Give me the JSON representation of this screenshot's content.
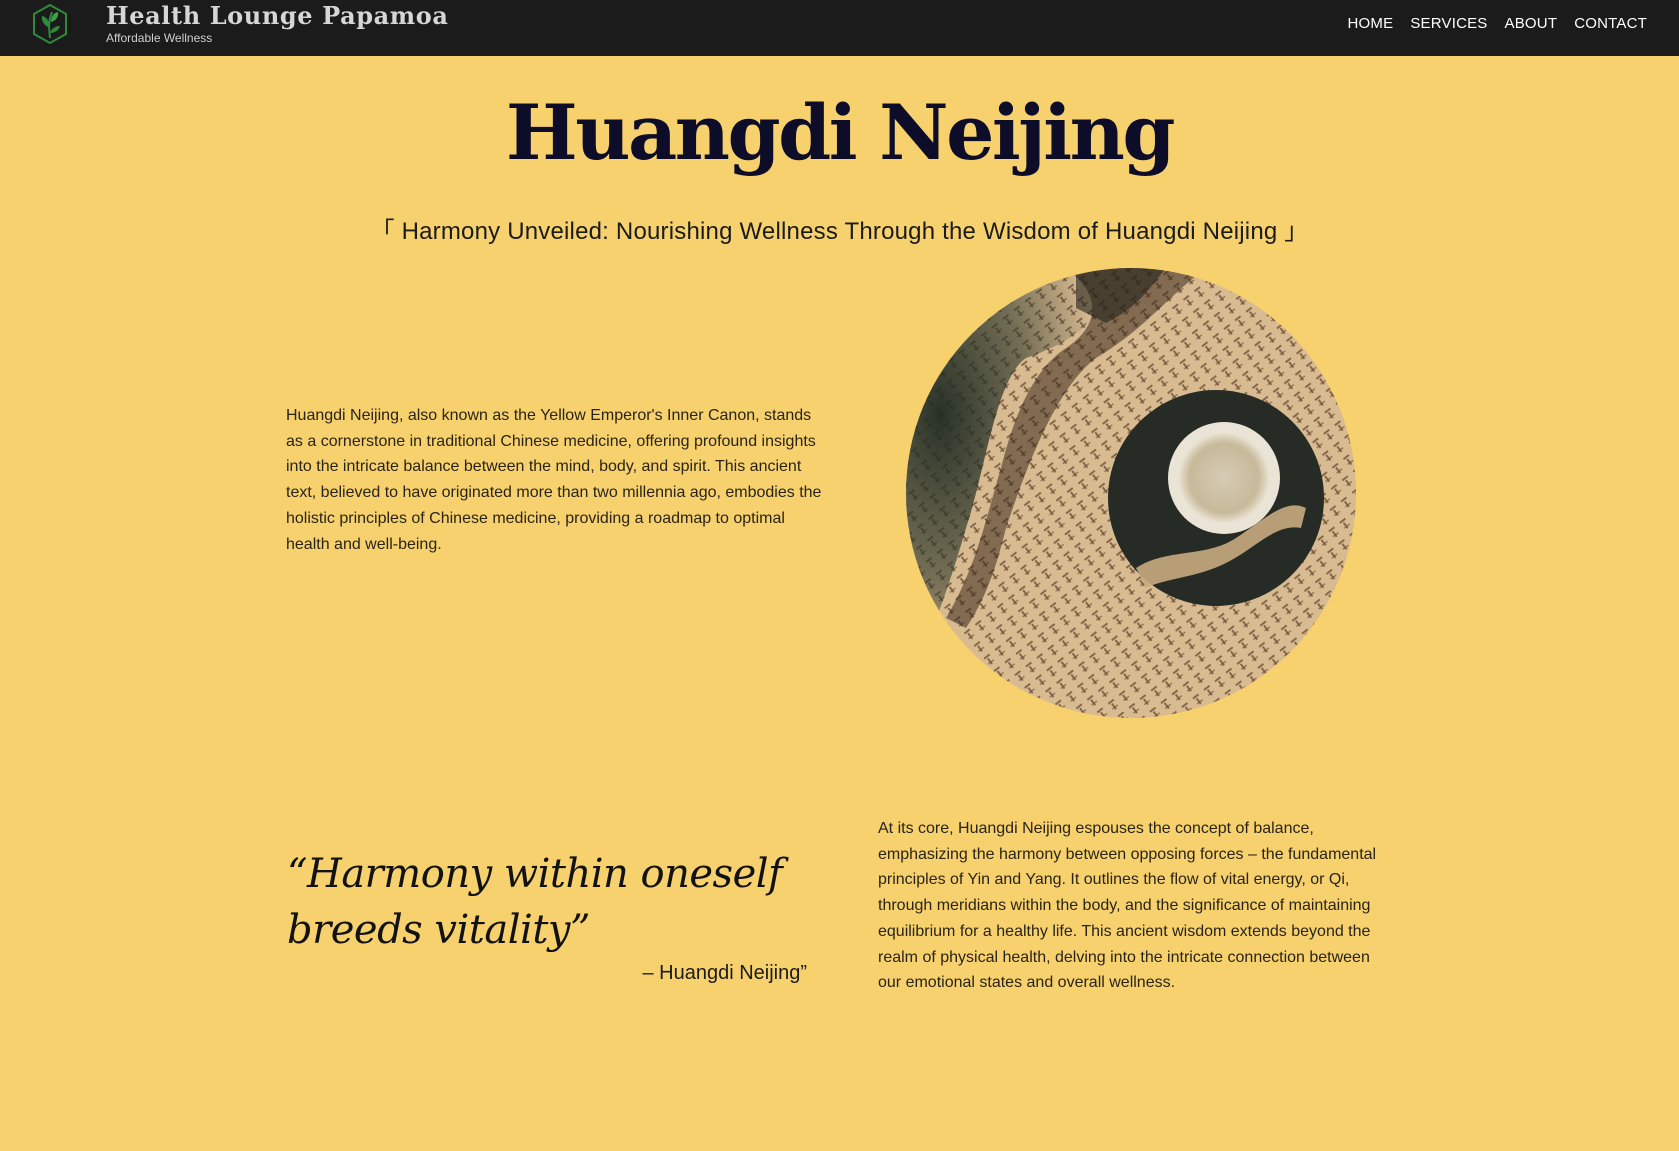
{
  "header": {
    "brand": "Health Lounge Papamoa",
    "tagline": "Affordable Wellness",
    "nav": [
      "HOME",
      "SERVICES",
      "ABOUT",
      "CONTACT"
    ]
  },
  "main": {
    "title": "Huangdi Neijing",
    "subtitle": "「 Harmony Unveiled: Nourishing Wellness Through the Wisdom of Huangdi Neijing 」",
    "intro": "Huangdi Neijing, also known as the Yellow Emperor's Inner Canon, stands as a cornerstone in traditional Chinese medicine, offering profound insights into the intricate balance between the mind, body, and spirit. This ancient text, believed to have originated more than two millennia ago, embodies the holistic principles of Chinese medicine, providing a roadmap to optimal health and well-being.",
    "quote": "“Harmony within oneself breeds vitality”",
    "quote_author": "– Huangdi Neijing”",
    "body": "At its core, Huangdi Neijing espouses the concept of balance, emphasizing the harmony between opposing forces – the fundamental principles of Yin and Yang. It outlines the flow of vital energy, or Qi, through meridians within the body, and the significance of maintaining equilibrium for a healthy life. This ancient wisdom extends beyond the realm of physical health, delving into the intricate connection between our emotional states and overall wellness."
  },
  "colors": {
    "background": "#f6d16d",
    "header": "#1b1b1b",
    "title": "#0d0d2a",
    "logo": "#2e8b3a"
  },
  "icons": {
    "logo": "leaf-hexagon-logo",
    "image": "tea-cup-on-chinese-book-photo"
  }
}
